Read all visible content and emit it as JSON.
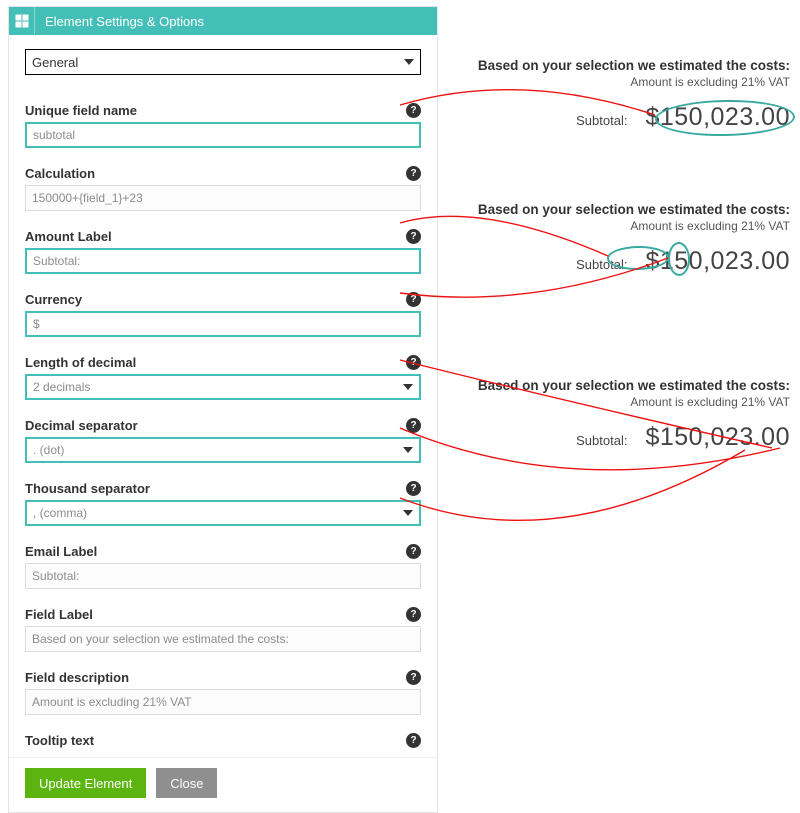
{
  "header": {
    "title": "Element Settings & Options"
  },
  "section_select": {
    "value": "General"
  },
  "fields": {
    "unique_name": {
      "label": "Unique field name",
      "value": "subtotal"
    },
    "calculation": {
      "label": "Calculation",
      "value": "150000+{field_1}+23"
    },
    "amount_label": {
      "label": "Amount Label",
      "value": "Subtotal:"
    },
    "currency": {
      "label": "Currency",
      "value": "$"
    },
    "decimals": {
      "label": "Length of decimal",
      "value": "2 decimals"
    },
    "dec_sep": {
      "label": "Decimal separator",
      "value": ". (dot)"
    },
    "tho_sep": {
      "label": "Thousand separator",
      "value": ", (comma)"
    },
    "email_label": {
      "label": "Email Label",
      "value": "Subtotal:"
    },
    "field_label": {
      "label": "Field Label",
      "value": "Based on your selection we estimated the costs:"
    },
    "field_desc": {
      "label": "Field description",
      "value": "Amount is excluding 21% VAT"
    },
    "tooltip": {
      "label": "Tooltip text",
      "value": ""
    }
  },
  "buttons": {
    "update": "Update Element",
    "close": "Close"
  },
  "help_glyph": "?",
  "preview": {
    "heading": "Based on your selection we estimated the costs:",
    "sub": "Amount is excluding 21% VAT",
    "label": "Subtotal:",
    "amount": "$150,023.00",
    "split": {
      "currency": "$",
      "rest": "150,023.00"
    }
  }
}
